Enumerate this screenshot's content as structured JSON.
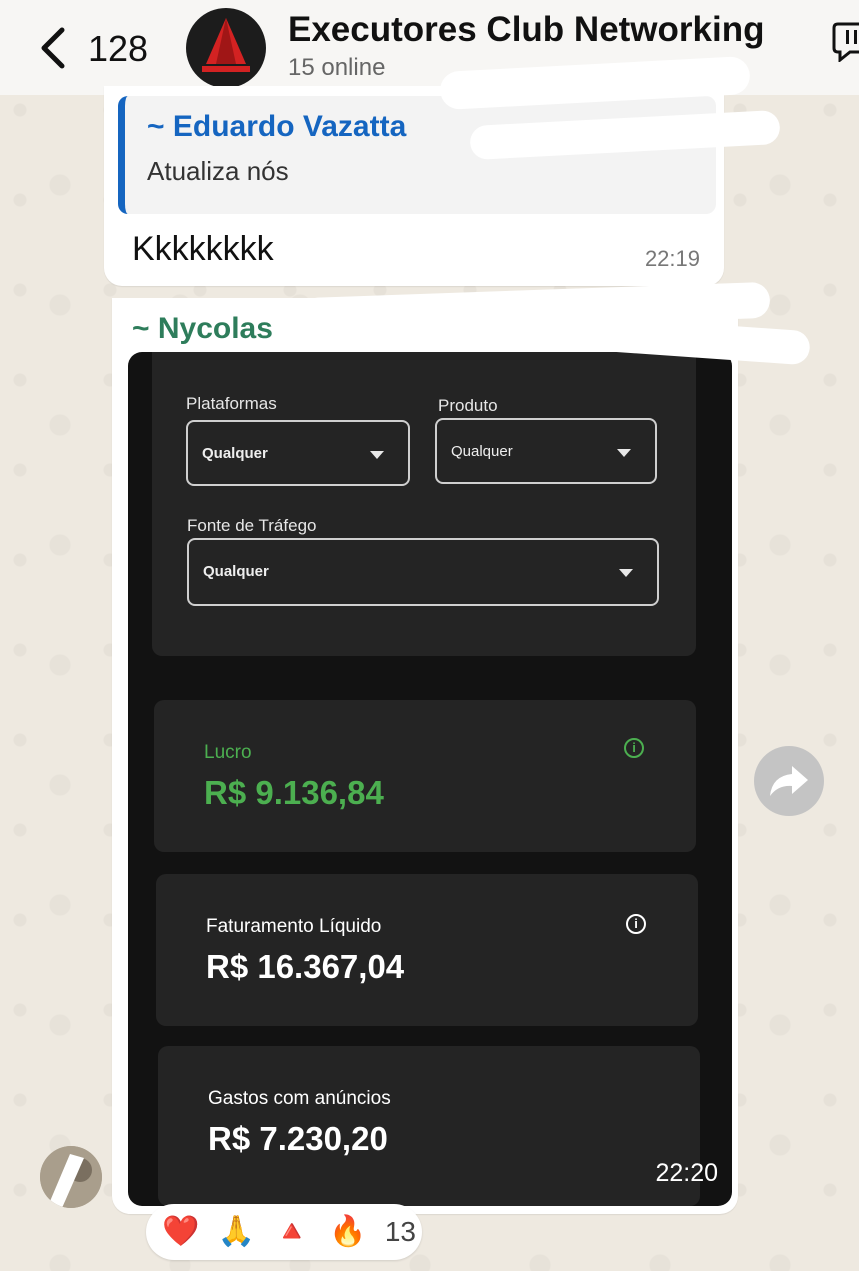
{
  "header": {
    "unread_count": "128",
    "title": "Executores Club Networking",
    "subtitle": "15 online"
  },
  "messages": [
    {
      "quote_author": "~ Eduardo Vazatta",
      "quote_text": "Atualiza nós",
      "text": "Kkkkkkkk",
      "time": "22:19"
    },
    {
      "sender": "~ Nycolas",
      "time": "22:20"
    }
  ],
  "screenshot": {
    "filters": {
      "platforms_label": "Plataformas",
      "platforms_value": "Qualquer",
      "product_label": "Produto",
      "product_value": "Qualquer",
      "traffic_label": "Fonte de Tráfego",
      "traffic_value": "Qualquer"
    },
    "metrics": [
      {
        "label": "Lucro",
        "value": "R$ 9.136,84",
        "color": "#4caf50"
      },
      {
        "label": "Faturamento Líquido",
        "value": "R$ 16.367,04",
        "color": "#ffffff"
      },
      {
        "label": "Gastos com anúncios",
        "value": "R$ 7.230,20",
        "color": "#ffffff"
      }
    ]
  },
  "reactions": {
    "emojis": [
      "❤️",
      "🙏",
      "🔺",
      "🔥"
    ],
    "count": "13"
  }
}
